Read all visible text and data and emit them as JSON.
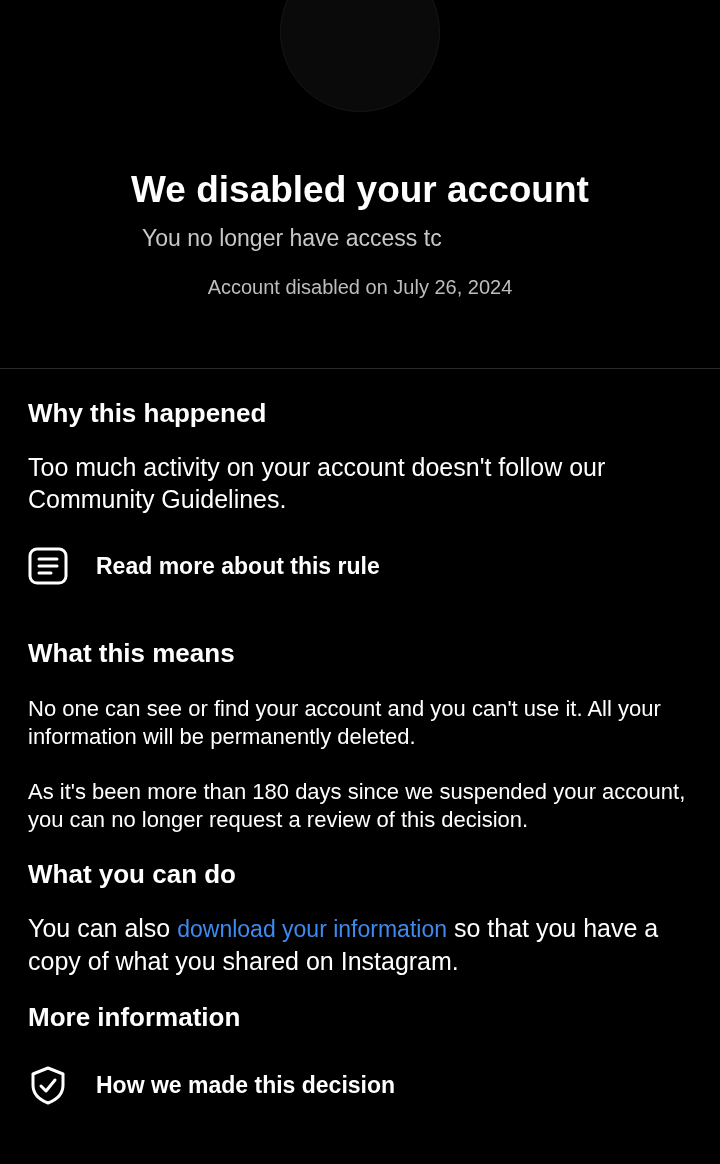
{
  "header": {
    "title": "We disabled your account",
    "subtitle": "You no longer have access tc",
    "date": "Account disabled on July 26, 2024"
  },
  "sections": [
    {
      "heading": "Why this happened",
      "paragraphs": [
        [
          {
            "text": "Too much activity on your account doesn't follow our Community Guidelines."
          }
        ]
      ],
      "actions": [
        {
          "kind": "document",
          "label": "Read more about this rule"
        }
      ]
    },
    {
      "heading": "What this means",
      "paragraphs": [
        [
          {
            "text": "No one can see or find your account and you can't use it. All your information will be permanently deleted."
          }
        ],
        [
          {
            "text": "As it's been more than 180 days since we suspended your account, you can no longer request a review of this decision."
          }
        ]
      ]
    },
    {
      "heading": "What you can do",
      "paragraphs": [
        [
          {
            "text": "You can also "
          },
          {
            "text": "download your information",
            "kind": "link"
          },
          {
            "text": " so that you have a copy of what you shared on Instagram."
          }
        ]
      ]
    },
    {
      "heading": "More information",
      "actions": [
        {
          "kind": "shield",
          "label": "How we made this decision"
        }
      ]
    }
  ]
}
